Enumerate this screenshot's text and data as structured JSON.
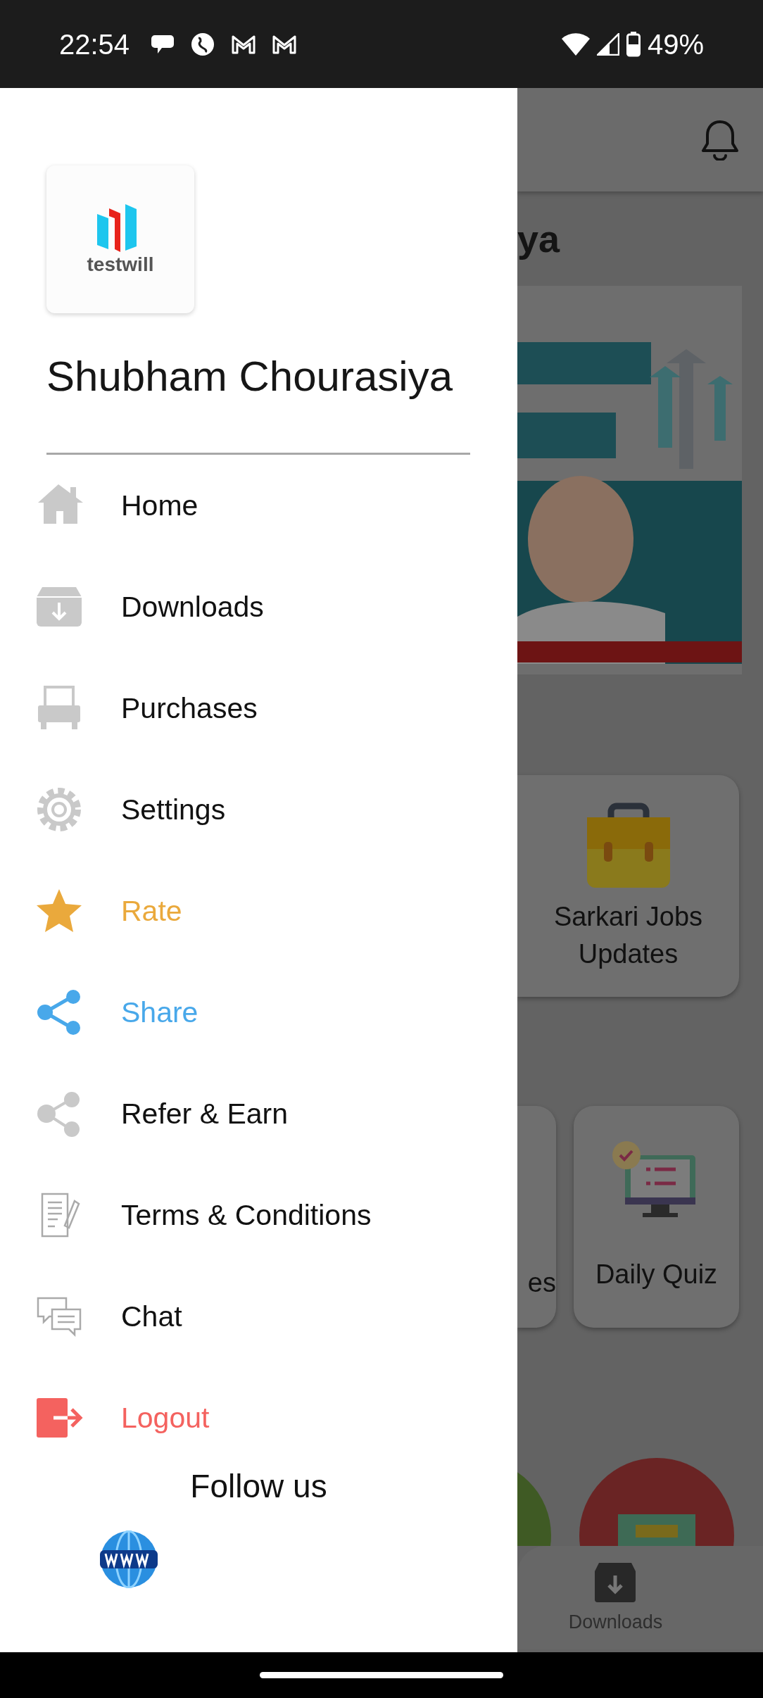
{
  "status_bar": {
    "time": "22:54",
    "battery": "49%"
  },
  "drawer": {
    "logo_text": "testwill",
    "user_name": "Shubham Chourasiya",
    "items": [
      {
        "label": "Home",
        "kind": "home",
        "color": "#111111"
      },
      {
        "label": "Downloads",
        "kind": "downloads",
        "color": "#111111"
      },
      {
        "label": "Purchases",
        "kind": "purchases",
        "color": "#111111"
      },
      {
        "label": "Settings",
        "kind": "settings",
        "color": "#111111"
      },
      {
        "label": "Rate",
        "kind": "rate",
        "color": "#eaa93c"
      },
      {
        "label": "Share",
        "kind": "share",
        "color": "#48a8ea"
      },
      {
        "label": "Refer & Earn",
        "kind": "refer",
        "color": "#111111"
      },
      {
        "label": "Terms & Conditions",
        "kind": "terms",
        "color": "#111111"
      },
      {
        "label": "Chat",
        "kind": "chat",
        "color": "#111111"
      },
      {
        "label": "Logout",
        "kind": "logout",
        "color": "#f4625f"
      }
    ],
    "follow_us": "Follow us"
  },
  "background": {
    "heading": "ya",
    "cards": [
      {
        "label": "Sarkari Jobs Updates"
      },
      {
        "label": "es"
      },
      {
        "label": "Daily Quiz"
      }
    ],
    "bottom_nav": [
      {
        "label": "Downloads"
      }
    ]
  }
}
